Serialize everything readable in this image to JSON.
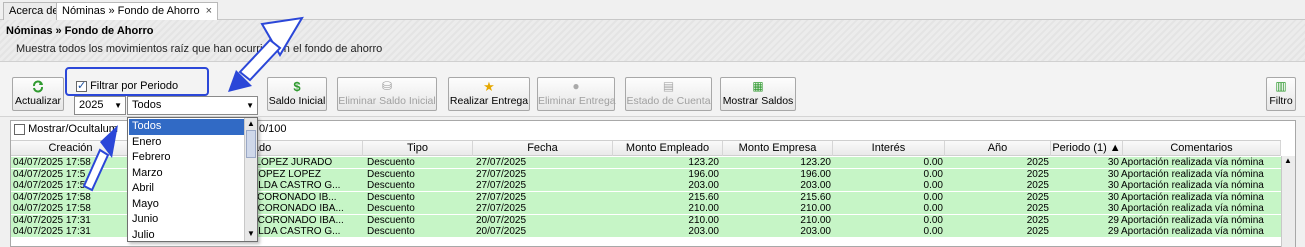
{
  "tabs": [
    {
      "label": "Acerca de"
    },
    {
      "label": "Nóminas » Fondo de Ahorro",
      "close": "×"
    }
  ],
  "header": {
    "title": "Nóminas » Fondo de Ahorro",
    "description": "Muestra todos los movimientos raíz que han ocurrido en el fondo de ahorro"
  },
  "toolbar": {
    "actualizar": "Actualizar",
    "filtrar_label": "Filtrar por Periodo",
    "year_value": "2025",
    "period_value": "Todos",
    "saldo_inicial": "Saldo Inicial",
    "eliminar_saldo": "Eliminar Saldo Inicial",
    "realizar_entrega": "Realizar Entrega",
    "eliminar_entrega": "Eliminar Entrega",
    "estado_cuenta": "Estado de Cuenta",
    "mostrar_saldos": "Mostrar Saldos",
    "filtro": "Filtro"
  },
  "grid": {
    "mostrar_label": "Mostrar/Oculta",
    "mostrar_suffix": "lum",
    "counter": "0/100",
    "columns": [
      "Creación",
      "Empleado",
      "Tipo",
      "Fecha",
      "Monto Empleado",
      "Monto Empresa",
      "Interés",
      "Año",
      "Periodo (1)",
      "Comentarios"
    ],
    "rows": [
      {
        "creacion": "04/07/2025 17:58",
        "empleado": "LA LOPEZ JURADO",
        "tipo": "Descuento",
        "fecha": "27/07/2025",
        "monto_empleado": "123.20",
        "monto_empresa": "123.20",
        "interes": "0.00",
        "anio": "2025",
        "periodo": "30",
        "comentarios": "Aportación realizada vía nómina"
      },
      {
        "creacion": "04/07/2025 17:5",
        "empleado": "IA LOPEZ LOPEZ",
        "tipo": "Descuento",
        "fecha": "27/07/2025",
        "monto_empleado": "196.00",
        "monto_empresa": "196.00",
        "interes": "0.00",
        "anio": "2025",
        "periodo": "30",
        "comentarios": "Aportación realizada vía nómina"
      },
      {
        "creacion": "04/07/2025 17:58",
        "empleado": "UNILDA CASTRO G...",
        "tipo": "Descuento",
        "fecha": "27/07/2025",
        "monto_empleado": "203.00",
        "monto_empresa": "203.00",
        "interes": "0.00",
        "anio": "2025",
        "periodo": "30",
        "comentarios": "Aportación realizada vía nómina"
      },
      {
        "creacion": "04/07/2025 17:58",
        "empleado": "DA CORONADO IB...",
        "tipo": "Descuento",
        "fecha": "27/07/2025",
        "monto_empleado": "215.60",
        "monto_empresa": "215.60",
        "interes": "0.00",
        "anio": "2025",
        "periodo": "30",
        "comentarios": "Aportación realizada vía nómina"
      },
      {
        "creacion": "04/07/2025 17:58",
        "empleado": "AN CORONADO IBA...",
        "tipo": "Descuento",
        "fecha": "27/07/2025",
        "monto_empleado": "210.00",
        "monto_empresa": "210.00",
        "interes": "0.00",
        "anio": "2025",
        "periodo": "30",
        "comentarios": "Aportación realizada vía nómina"
      },
      {
        "creacion": "04/07/2025 17:31",
        "empleado": "AN CORONADO IBA...",
        "tipo": "Descuento",
        "fecha": "20/07/2025",
        "monto_empleado": "210.00",
        "monto_empresa": "210.00",
        "interes": "0.00",
        "anio": "2025",
        "periodo": "29",
        "comentarios": "Aportación realizada vía nómina"
      },
      {
        "creacion": "04/07/2025 17:31",
        "empleado": "UNILDA CASTRO G...",
        "tipo": "Descuento",
        "fecha": "20/07/2025",
        "monto_empleado": "203.00",
        "monto_empresa": "203.00",
        "interes": "0.00",
        "anio": "2025",
        "periodo": "29",
        "comentarios": "Aportación realizada vía nómina"
      }
    ]
  },
  "dropdown": {
    "options": [
      "Todos",
      "Enero",
      "Febrero",
      "Marzo",
      "Abril",
      "Mayo",
      "Junio",
      "Julio"
    ],
    "selected": "Todos"
  },
  "colors": {
    "row_green": "#c6f5c6",
    "selection_blue": "#316ac5",
    "annotation_blue": "#2b47d8"
  }
}
